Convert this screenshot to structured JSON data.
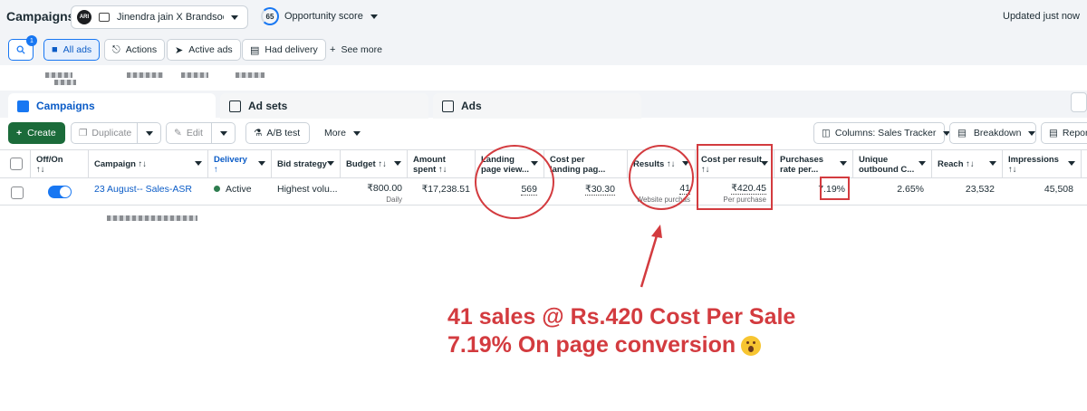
{
  "header": {
    "title": "Campaigns",
    "account_name": "Jinendra jain X Brandsoo...",
    "account_logo": "ARI",
    "opportunity_score": "65",
    "opportunity_label": "Opportunity score",
    "updated": "Updated just now"
  },
  "filters": {
    "search_badge": "1",
    "all_ads": "All ads",
    "actions": "Actions",
    "active_ads": "Active ads",
    "had_delivery": "Had delivery",
    "see_more": "See more"
  },
  "tabs": [
    {
      "label": "Campaigns"
    },
    {
      "label": "Ad sets"
    },
    {
      "label": "Ads"
    }
  ],
  "toolbar": {
    "create": "Create",
    "duplicate": "Duplicate",
    "edit": "Edit",
    "ab_test": "A/B test",
    "more": "More",
    "columns": "Columns: Sales Tracker",
    "breakdown": "Breakdown",
    "reports": "Report"
  },
  "table": {
    "headers": {
      "offon": "Off/On",
      "offon_sort": "↑↓",
      "campaign": "Campaign ↑↓",
      "delivery": "Delivery",
      "delivery_sort": "↑",
      "bid_strategy": "Bid strategy",
      "budget": "Budget ↑↓",
      "amount_1": "Amount",
      "amount_2": "spent ↑↓",
      "landing_1": "Landing",
      "landing_2": "page view...",
      "cpl_1": "Cost per",
      "cpl_2": "landing pag...",
      "results": "Results ↑↓",
      "cpr_1": "Cost per result",
      "cpr_2": "↑↓",
      "pr_1": "Purchases",
      "pr_2": "rate per...",
      "uo_1": "Unique",
      "uo_2": "outbound C...",
      "reach": "Reach ↑↓",
      "impressions_1": "Impressions",
      "impressions_2": "↑↓"
    },
    "row": {
      "campaign": "23 August-- Sales-ASR",
      "delivery": "Active",
      "bid_strategy": "Highest volu...",
      "budget": "₹800.00",
      "budget_sub": "Daily",
      "amount_spent": "₹17,238.51",
      "landing_page_views": "569",
      "cost_per_landing": "₹30.30",
      "results": "41",
      "results_sub": "Website purchas",
      "cost_per_result": "₹420.45",
      "cost_per_result_sub": "Per purchase",
      "purchase_rate": "7.19%",
      "unique_outbound": "2.65%",
      "reach": "23,532",
      "impressions": "45,508"
    }
  },
  "annotation": {
    "line1": "41 sales @ Rs.420 Cost Per Sale",
    "line2": "7.19% On page conversion",
    "color": "#d33b3f"
  }
}
